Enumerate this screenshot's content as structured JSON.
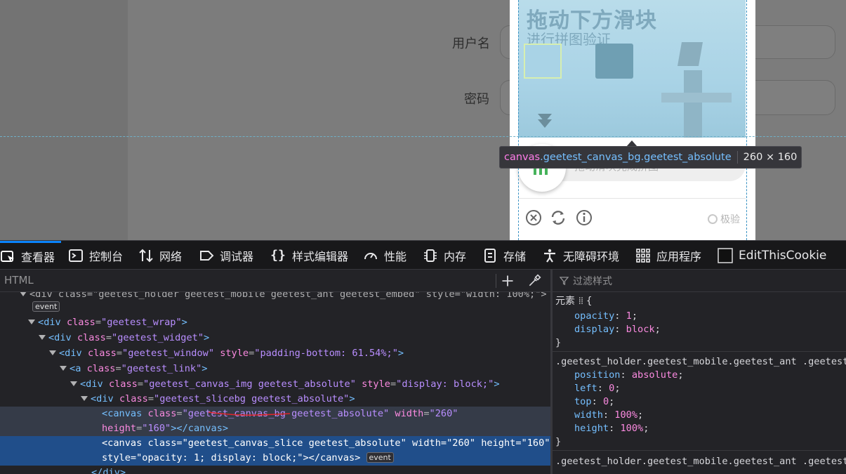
{
  "page": {
    "username_label": "用户名",
    "password_label": "密码"
  },
  "captcha": {
    "title": "拖动下方滑块",
    "subtitle": "进行拼图验证",
    "slider_tip": "拖动滑块完成拼图",
    "brand": "极验"
  },
  "tooltip": {
    "tag": "canvas",
    "classes": ".geetest_canvas_bg.geetest_absolute",
    "size": "260 × 160"
  },
  "devtools": {
    "tabs": [
      {
        "label": "查看器",
        "icon": "inspector-icon"
      },
      {
        "label": "控制台",
        "icon": "console-icon"
      },
      {
        "label": "网络",
        "icon": "network-icon"
      },
      {
        "label": "调试器",
        "icon": "debugger-icon"
      },
      {
        "label": "样式编辑器",
        "icon": "style-editor-icon"
      },
      {
        "label": "性能",
        "icon": "performance-icon"
      },
      {
        "label": "内存",
        "icon": "memory-icon"
      },
      {
        "label": "存储",
        "icon": "storage-icon"
      },
      {
        "label": "无障碍环境",
        "icon": "accessibility-icon"
      },
      {
        "label": "应用程序",
        "icon": "application-icon"
      },
      {
        "label": "EditThisCookie",
        "icon": "cookie-icon"
      }
    ],
    "search_placeholder": "HTML",
    "filter_placeholder": "过滤样式",
    "markup": {
      "line0": "<div class=\"geetest_holder geetest_mobile geetest_ant geetest_embed\" style=\"width: 100%;\">",
      "event": "event",
      "line_wrap_tag": "div",
      "line_wrap_attr": "class",
      "line_wrap_val": "geetest_wrap",
      "line_widget_val": "geetest_widget",
      "line_window_val": "geetest_window",
      "line_window_style": "padding-bottom: 61.54%;",
      "line_link_tag": "a",
      "line_link_val": "geetest_link",
      "line_img_val": "geetest_canvas_img geetest_absolute",
      "line_img_style": "display: block;",
      "line_slicebg_val": "geetest_slicebg geetest_absolute",
      "canvas_tag": "canvas",
      "canvas_bg_class": "geetest_canvas_bg geetest_absolute",
      "canvas_bg_width": "260",
      "canvas_bg_height": "160",
      "canvas_slice_class": "geetest_canvas_slice geetest_absolute",
      "canvas_slice_width": "260",
      "canvas_slice_height": "160",
      "canvas_slice_style_a": "opacity: 1; ",
      "canvas_slice_style_b": "display: block;",
      "closing_div": "</div>"
    },
    "rules": {
      "element_label": "元素",
      "r1_p1": "opacity",
      "r1_v1": "1",
      "r1_p2": "display",
      "r1_v2": "block",
      "selector2": ".geetest_holder.geetest_mobile.geetest_ant .geetest_",
      "r2_p1": "position",
      "r2_v1": "absolute",
      "r2_p2": "left",
      "r2_v2": "0",
      "r2_p3": "top",
      "r2_v3": "0",
      "r2_p4": "width",
      "r2_v4": "100%",
      "r2_p5": "height",
      "r2_v5": "100%",
      "selector3": ".geetest_holder.geetest_mobile.geetest_ant .geetest_"
    }
  },
  "colors": {
    "selected_row": "#204e8a",
    "active_tab_accent": "#0a84ff",
    "tag": "#75bfff",
    "attr": "#fb8ae0",
    "value": "#b98eff"
  }
}
